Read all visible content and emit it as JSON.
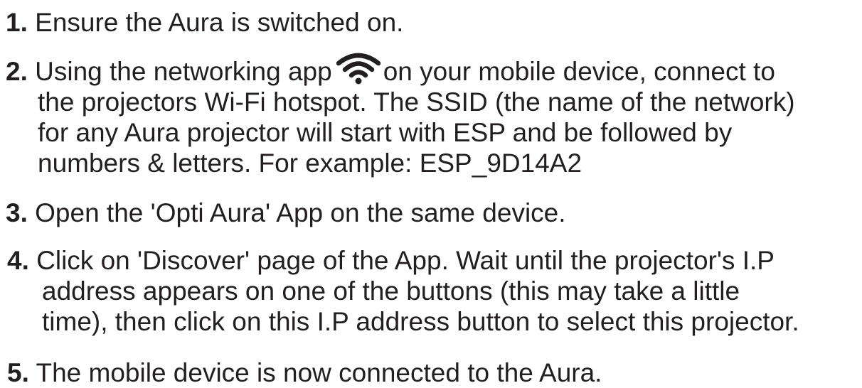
{
  "steps": [
    {
      "number": "1.",
      "lines": [
        "Ensure the Aura is switched on."
      ]
    },
    {
      "number": "2.",
      "line1_before_icon": "Using the networking app",
      "icon": "wifi-icon",
      "line1_after_icon": "on your mobile device, connect to",
      "lines": [
        "the projectors Wi-Fi hotspot. The SSID (the name of the network)",
        "for any Aura projector will start with ESP and be followed by",
        "numbers & letters. For example: ESP_9D14A2"
      ]
    },
    {
      "number": "3.",
      "lines": [
        "Open the 'Opti Aura' App on the same device."
      ]
    },
    {
      "number": "4.",
      "lines": [
        "Click on 'Discover' page of the App. Wait until the projector's I.P",
        "address appears on one of the buttons (this may take a little",
        "time), then click on this I.P address button to select this projector."
      ]
    },
    {
      "number": "5.",
      "lines": [
        "The mobile device is now connected to the Aura."
      ]
    }
  ]
}
